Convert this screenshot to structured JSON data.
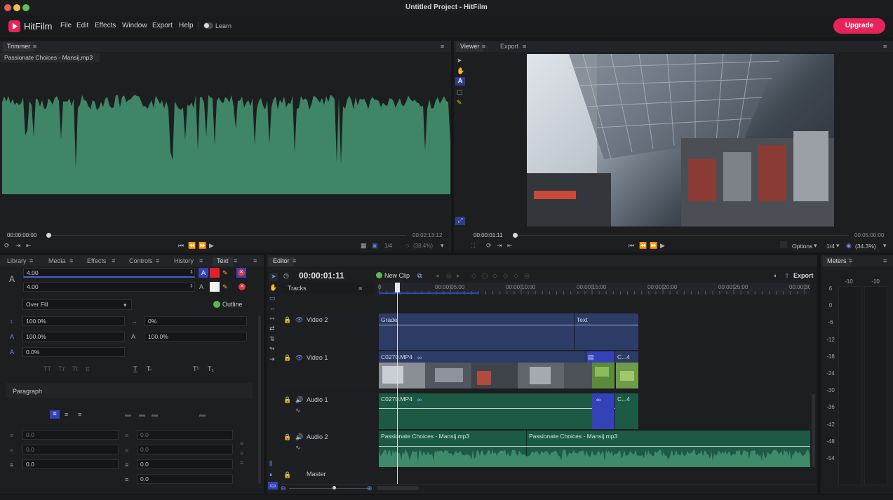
{
  "window": {
    "title": "Untitled Project - HitFilm"
  },
  "menu": {
    "app_name": "HitFilm",
    "items": [
      "File",
      "Edit",
      "Effects",
      "Window",
      "Export",
      "Help"
    ],
    "learn": "Learn",
    "upgrade": "Upgrade"
  },
  "trimmer": {
    "tab": "Trimmer",
    "file": "Passionate Choices - Mansij.mp3",
    "time_start": "00:00:00:00",
    "time_end": "00:02:13:12",
    "zoom_fraction": "1/4",
    "zoom_pct": "(38.4%)"
  },
  "viewer": {
    "tabs": [
      "Viewer",
      "Export"
    ],
    "time_current": "00:00:01:11",
    "time_end": "00:05:00:00",
    "options": "Options",
    "zoom_fraction": "1/4",
    "zoom_pct": "(34.3%)"
  },
  "left_tabs": [
    "Library",
    "Media",
    "Effects",
    "Controls",
    "History",
    "Text"
  ],
  "text_panel": {
    "stroke1": "4.00",
    "stroke2": "4.00",
    "fill_mode": "Over Fill",
    "outline": "Outline",
    "vscale": "100.0%",
    "tracking": "0%",
    "hscale": "100.0%",
    "hscale2": "100.0%",
    "baseline": "0.0%",
    "paragraph": "Paragraph",
    "indent_left": "0.0",
    "indent_first": "0.0",
    "space_before": "0.0",
    "space_after": "0.0",
    "indent_right": "0.0",
    "space_line": "0.0",
    "extra": "0.0",
    "color_red": "#e0202a",
    "color_white": "#f2f2f2"
  },
  "editor": {
    "tab": "Editor",
    "timecode": "00:00:01:11",
    "new_clip": "New Clip",
    "export": "Export",
    "tracks_label": "Tracks",
    "ruler": [
      "0",
      "00:00:05:00",
      "00:00:10:00",
      "00:00:15:00",
      "00:00:20:00",
      "00:00:25:00",
      "00:00:30:"
    ],
    "tracks": {
      "video2": "Video 2",
      "video1": "Video 1",
      "audio1": "Audio 1",
      "audio2": "Audio 2",
      "master": "Master"
    },
    "clips": {
      "grade": "Grade",
      "text": "Text",
      "v1_main": "C0270.MP4",
      "v1_short": "C...4",
      "a1_main": "C0270.MP4",
      "a1_short": "C...4",
      "a2_a": "Passionate Choices - Mansij.mp3",
      "a2_b": "Passionate Choices - Mansij.mp3"
    }
  },
  "meters": {
    "tab": "Meters",
    "peak_l": "-10",
    "peak_r": "-10",
    "scale": [
      "6",
      "0",
      "-6",
      "-12",
      "-18",
      "-24",
      "-30",
      "-36",
      "-42",
      "-48",
      "-54"
    ]
  },
  "colors": {
    "accent": "#e8235b",
    "audio_green": "#3e8667",
    "clip_blue": "#2d3c66",
    "selection_blue": "#3442b8"
  }
}
